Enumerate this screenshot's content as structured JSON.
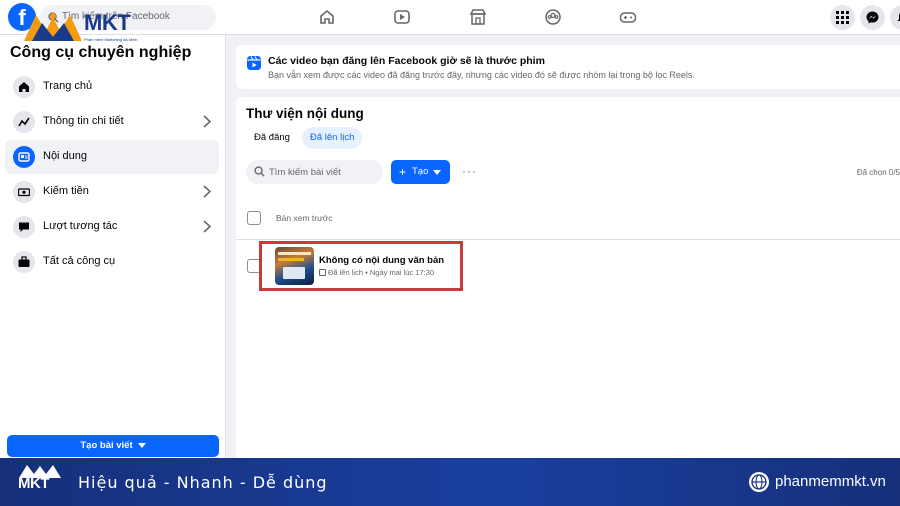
{
  "topbar": {
    "logo_letter": "f",
    "search_placeholder": "Tìm kiếm trên Facebook",
    "nav_icons": [
      "home-icon",
      "video-icon",
      "marketplace-icon",
      "groups-icon",
      "gaming-icon"
    ],
    "right_icons": [
      "menu-grid-icon",
      "messenger-icon",
      "notifications-icon"
    ]
  },
  "watermark": {
    "brand": "MKT",
    "tagline": "Phần mềm Marketing đa kênh"
  },
  "sidebar": {
    "title": "Công cụ chuyên nghiệp",
    "items": [
      {
        "label": "Trang chủ",
        "icon": "home-icon",
        "has_chevron": false,
        "active": false
      },
      {
        "label": "Thông tin chi tiết",
        "icon": "insights-icon",
        "has_chevron": true,
        "active": false
      },
      {
        "label": "Nội dung",
        "icon": "content-icon",
        "has_chevron": false,
        "active": true
      },
      {
        "label": "Kiếm tiền",
        "icon": "monetization-icon",
        "has_chevron": true,
        "active": false
      },
      {
        "label": "Lượt tương tác",
        "icon": "engagement-icon",
        "has_chevron": true,
        "active": false
      },
      {
        "label": "Tất cả công cụ",
        "icon": "toolbox-icon",
        "has_chevron": false,
        "active": false
      }
    ],
    "create_post_label": "Tạo bài viết"
  },
  "notice": {
    "title": "Các video bạn đăng lên Facebook giờ sẽ là thước phim",
    "description": "Bạn vẫn xem được các video đã đăng trước đây, nhưng các video đó sẽ được nhóm lại trong bộ lọc Reels."
  },
  "library": {
    "title": "Thư viện nội dung",
    "tabs": [
      {
        "label": "Đã đăng",
        "active": false
      },
      {
        "label": "Đã lên lịch",
        "active": true
      }
    ],
    "search_placeholder": "Tìm kiếm bài viết",
    "create_label": "Tạo",
    "create_plus": "+",
    "more_label": "···",
    "selected_count": "Đã chọn 0/5",
    "column_header": "Bản xem trước",
    "posts": [
      {
        "title": "Không có nội dung văn bản",
        "status": "Đã lên lịch",
        "separator": "•",
        "schedule": "Ngày mai lúc 17:30",
        "highlighted": true
      }
    ]
  },
  "banner": {
    "brand": "MKT",
    "slogan": "Hiệu quả - Nhanh  - Dễ dùng",
    "website": "phanmemmkt.vn",
    "accent_color": "#16307a"
  },
  "colors": {
    "facebook_blue": "#0866ff",
    "highlight_red": "#c9393d",
    "background": "#f0f2f5"
  }
}
